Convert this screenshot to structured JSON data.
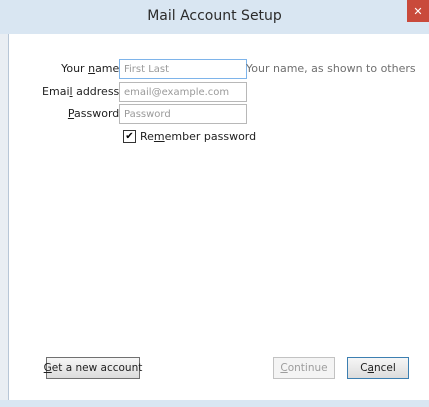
{
  "window": {
    "title": "Mail Account Setup",
    "close_glyph": "✕"
  },
  "form": {
    "name": {
      "label_pre": "Your ",
      "label_access": "n",
      "label_post": "ame:",
      "placeholder": "First Last",
      "hint": "Your name, as shown to others"
    },
    "email": {
      "label_pre": "Emai",
      "label_access": "l",
      "label_post": " address:",
      "placeholder": "email@example.com"
    },
    "password": {
      "label_pre": "",
      "label_access": "P",
      "label_post": "assword:",
      "placeholder": "Password"
    },
    "remember": {
      "checked": true,
      "check_glyph": "✔",
      "label_pre": "Re",
      "label_access": "m",
      "label_post": "ember password"
    }
  },
  "buttons": {
    "get_account": {
      "pre": "",
      "access": "G",
      "post": "et a new account"
    },
    "continue": {
      "pre": "",
      "access": "C",
      "post": "ontinue",
      "enabled": false
    },
    "cancel": {
      "pre": "C",
      "access": "a",
      "post": "ncel"
    }
  }
}
